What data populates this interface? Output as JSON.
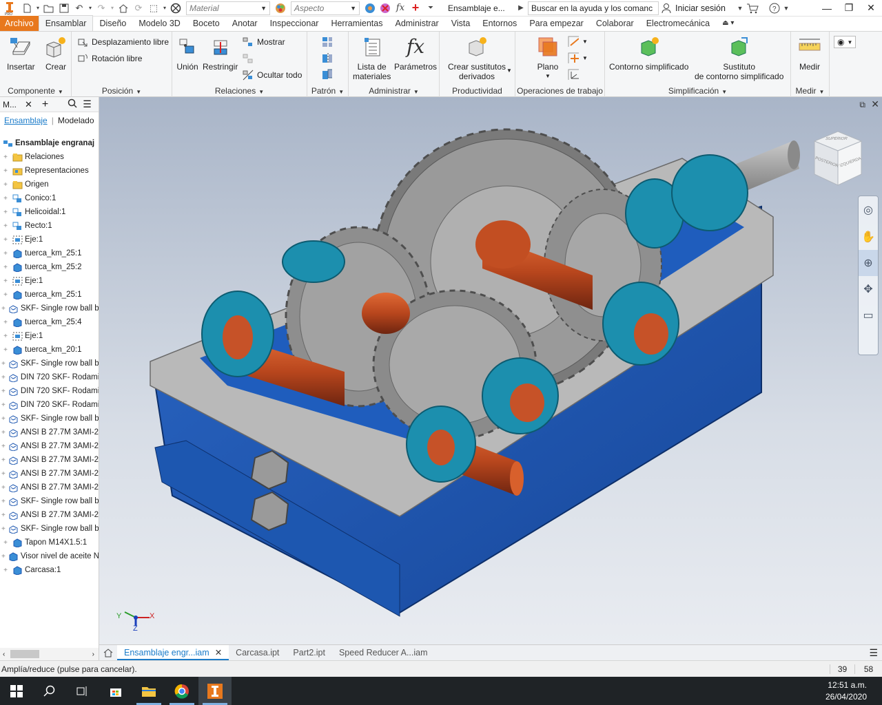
{
  "quick_access": {
    "material_placeholder": "Material",
    "appearance_placeholder": "Aspecto",
    "fx_label": "fx",
    "document_title": "Ensamblaje e...",
    "help_search": "Buscar en la ayuda y los comanc",
    "sign_in": "Iniciar sesión"
  },
  "ribbon_tabs": [
    "Archivo",
    "Ensamblar",
    "Diseño",
    "Modelo 3D",
    "Boceto",
    "Anotar",
    "Inspeccionar",
    "Herramientas",
    "Administrar",
    "Vista",
    "Entornos",
    "Para empezar",
    "Colaborar",
    "Electromecánica"
  ],
  "ribbon": {
    "componente": {
      "label": "Componente",
      "insertar": "Insertar",
      "crear": "Crear"
    },
    "posicion": {
      "label": "Posición",
      "desplazamiento": "Desplazamiento libre",
      "rotacion": "Rotación libre"
    },
    "relaciones": {
      "label": "Relaciones",
      "union": "Unión",
      "restringir": "Restringir",
      "mostrar": "Mostrar",
      "ocultar": "Ocultar todo"
    },
    "patron": {
      "label": "Patrón"
    },
    "administrar": {
      "label": "Administrar",
      "lista_1": "Lista de",
      "lista_2": "materiales",
      "parametros": "Parámetros",
      "fx_glyph": "fx"
    },
    "productividad": {
      "label": "Productividad",
      "crear_1": "Crear sustitutos",
      "crear_2": "derivados"
    },
    "operaciones": {
      "label": "Operaciones de trabajo",
      "plano": "Plano"
    },
    "simplificacion": {
      "label": "Simplificación",
      "contorno": "Contorno simplificado",
      "sustituto_1": "Sustituto",
      "sustituto_2": "de contorno simplificado"
    },
    "medir": {
      "label": "Medir",
      "medir": "Medir"
    }
  },
  "browser": {
    "title": "M...",
    "tab_ensamblaje": "Ensamblaje",
    "tab_modelado": "Modelado",
    "root": "Ensamblaje engranaj",
    "items": [
      {
        "label": "Relaciones",
        "icon": "folder-icon"
      },
      {
        "label": "Representaciones",
        "icon": "representations-icon"
      },
      {
        "label": "Origen",
        "icon": "folder-icon"
      },
      {
        "label": "Conico:1",
        "icon": "subassembly-icon"
      },
      {
        "label": "Helicoidal:1",
        "icon": "subassembly-icon"
      },
      {
        "label": "Recto:1",
        "icon": "subassembly-icon"
      },
      {
        "label": "Eje:1",
        "icon": "shaft-icon"
      },
      {
        "label": "tuerca_km_25:1",
        "icon": "part-icon"
      },
      {
        "label": "tuerca_km_25:2",
        "icon": "part-icon"
      },
      {
        "label": "Eje:1",
        "icon": "shaft-icon"
      },
      {
        "label": "tuerca_km_25:1",
        "icon": "part-icon"
      },
      {
        "label": "SKF- Single row ball b",
        "icon": "bearing-icon"
      },
      {
        "label": "tuerca_km_25:4",
        "icon": "part-icon"
      },
      {
        "label": "Eje:1",
        "icon": "shaft-icon"
      },
      {
        "label": "tuerca_km_20:1",
        "icon": "part-icon"
      },
      {
        "label": "SKF- Single row ball b",
        "icon": "bearing-icon"
      },
      {
        "label": "DIN 720 SKF- Rodami",
        "icon": "bearing-icon"
      },
      {
        "label": "DIN 720 SKF- Rodami",
        "icon": "bearing-icon"
      },
      {
        "label": "DIN 720 SKF- Rodami",
        "icon": "bearing-icon"
      },
      {
        "label": "SKF- Single row ball b",
        "icon": "bearing-icon"
      },
      {
        "label": "ANSI B 27.7M 3AMI-2",
        "icon": "bearing-icon"
      },
      {
        "label": "ANSI B 27.7M 3AMI-2",
        "icon": "bearing-icon"
      },
      {
        "label": "ANSI B 27.7M 3AMI-2",
        "icon": "bearing-icon"
      },
      {
        "label": "ANSI B 27.7M 3AMI-2",
        "icon": "bearing-icon"
      },
      {
        "label": "ANSI B 27.7M 3AMI-2",
        "icon": "bearing-icon"
      },
      {
        "label": "SKF- Single row ball b",
        "icon": "bearing-icon"
      },
      {
        "label": "ANSI B 27.7M 3AMI-2",
        "icon": "bearing-icon"
      },
      {
        "label": "SKF- Single row ball b",
        "icon": "bearing-icon"
      },
      {
        "label": "Tapon M14X1.5:1",
        "icon": "part-icon"
      },
      {
        "label": "Visor nivel de aceite N",
        "icon": "part-icon"
      },
      {
        "label": "Carcasa:1",
        "icon": "part-icon"
      }
    ]
  },
  "viewcube": {
    "face_left": "POSTERIOR",
    "face_right": "IZQUIERDA",
    "face_top": "SUPERIOR"
  },
  "triad": {
    "x": "X",
    "y": "Y",
    "z": "Z"
  },
  "document_tabs": [
    "Ensamblaje engr...iam",
    "Carcasa.ipt",
    "Part2.ipt",
    "Speed Reducer A...iam"
  ],
  "status": {
    "message": "Amplía/reduce (pulse para cancelar).",
    "count1": "39",
    "count2": "58"
  },
  "taskbar": {
    "time": "12:51 a.m.",
    "date": "26/04/2020"
  },
  "colors": {
    "accent": "#e8781d",
    "housing": "#1d57b0",
    "gear": "#9a9a9a",
    "shaft": "#b8461d",
    "bearing": "#1c8fae",
    "link": "#1a7bc9"
  }
}
